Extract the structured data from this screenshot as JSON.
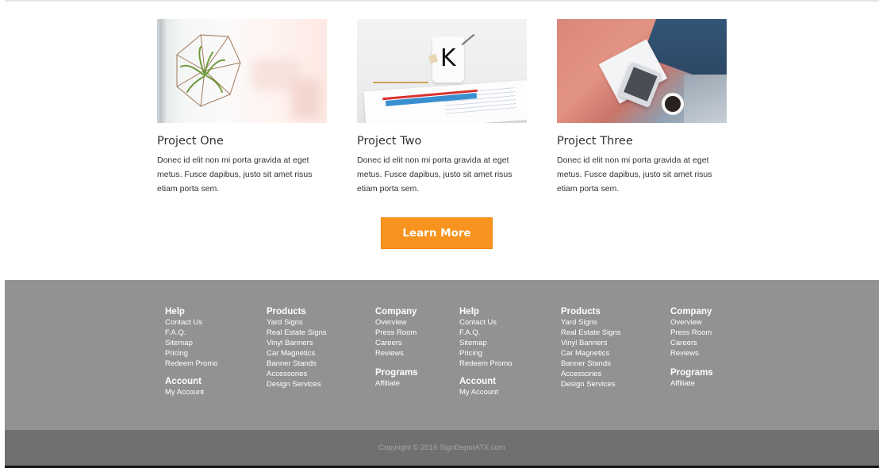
{
  "projects": [
    {
      "title": "Project One",
      "text": "Donec id elit non mi porta gravida at eget metus. Fusce dapibus, justo sit amet risus etiam porta sem."
    },
    {
      "title": "Project Two",
      "text": "Donec id elit non mi porta gravida at eget metus. Fusce dapibus, justo sit amet risus etiam porta sem.",
      "mug_letter": "K"
    },
    {
      "title": "Project Three",
      "text": "Donec id elit non mi porta gravida at eget metus. Fusce dapibus, justo sit amet risus etiam porta sem."
    }
  ],
  "cta": {
    "label": "Learn More",
    "color": "#f7931e"
  },
  "footer": {
    "background": "#929292",
    "columns": [
      {
        "sections": [
          {
            "heading": "Help",
            "links": [
              "Contact Us",
              "F.A.Q.",
              "Sitemap",
              "Pricing",
              "Redeem Promo"
            ]
          },
          {
            "heading": "Account",
            "links": [
              "My Account"
            ]
          }
        ]
      },
      {
        "sections": [
          {
            "heading": "Products",
            "links": [
              "Yard Signs",
              "Real Estate Signs",
              "Vinyl Banners",
              "Car Magnetics",
              "Banner Stands",
              "Accessories",
              "Design Services"
            ]
          }
        ]
      },
      {
        "sections": [
          {
            "heading": "Company",
            "links": [
              "Overview",
              "Press Room",
              "Careers",
              "Reviews"
            ]
          },
          {
            "heading": "Programs",
            "links": [
              "Affiliate"
            ]
          }
        ]
      },
      {
        "sections": [
          {
            "heading": "Help",
            "links": [
              "Contact Us",
              "F.A.Q.",
              "Sitemap",
              "Pricing",
              "Redeem Promo"
            ]
          },
          {
            "heading": "Account",
            "links": [
              "My Account"
            ]
          }
        ]
      },
      {
        "sections": [
          {
            "heading": "Products",
            "links": [
              "Yard Signs",
              "Real Estate Signs",
              "Vinyl Banners",
              "Car Magnetics",
              "Banner Stands",
              "Accessories",
              "Design Services"
            ]
          }
        ]
      },
      {
        "sections": [
          {
            "heading": "Company",
            "links": [
              "Overview",
              "Press Room",
              "Careers",
              "Reviews"
            ]
          },
          {
            "heading": "Programs",
            "links": [
              "Affiliate"
            ]
          }
        ]
      }
    ]
  },
  "copyright": "Copyright © 2016 SignDepotATX.com"
}
